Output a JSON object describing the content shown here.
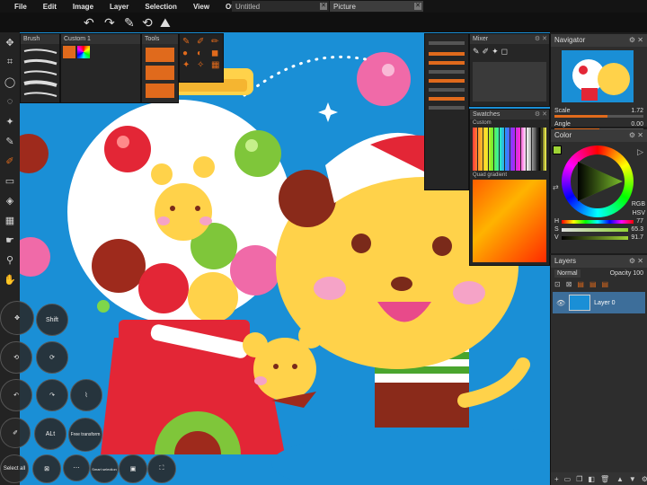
{
  "menu": {
    "items": [
      "File",
      "Edit",
      "Image",
      "Layer",
      "Selection",
      "View",
      "Other"
    ]
  },
  "tabs": [
    {
      "label": "Untitled"
    },
    {
      "label": "Picture"
    }
  ],
  "tab_close_glyph": "✕",
  "navigator": {
    "title": "Navigator",
    "scale_label": "Scale",
    "scale_value": "1.72",
    "angle_label": "Angle",
    "angle_value": "0.00"
  },
  "color": {
    "title": "Color",
    "mode_rgb": "RGB",
    "mode_hsv": "HSV",
    "h_label": "H",
    "h_value": "77",
    "s_label": "S",
    "s_value": "65.3",
    "v_label": "V",
    "v_value": "91.7"
  },
  "layers": {
    "title": "Layers",
    "blend_mode": "Normal",
    "opacity_label": "Opacity",
    "opacity_value": "100",
    "items": [
      {
        "name": "Layer 0"
      }
    ]
  },
  "swatches": {
    "title": "Swatches",
    "custom_label": "Custom",
    "quad_label": "Quad gradient"
  },
  "mixer": {
    "title": "Mixer"
  },
  "floating_panels": {
    "brush_title": "Brush",
    "custom_title": "Custom 1",
    "tools_title": "Tools"
  },
  "radial": {
    "shift_label": "Shift",
    "alt_label": "ALt",
    "free_transform_label": "Free transform",
    "select_all_label": "Select all",
    "smart_selection_label": "Smart selection"
  },
  "colors": {
    "canvas_bg": "#1a8fd6",
    "panel_bg": "#2d2d2d",
    "accent": "#e06a1c"
  }
}
